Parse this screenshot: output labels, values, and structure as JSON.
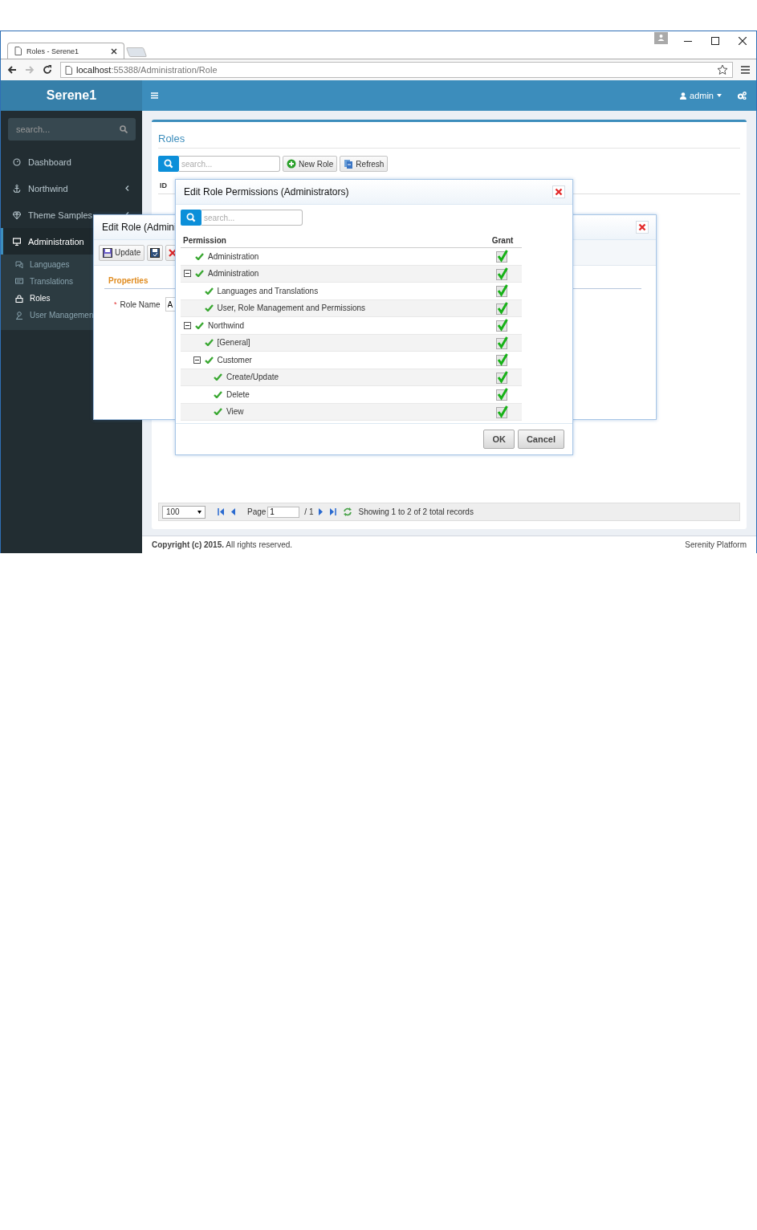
{
  "browser": {
    "tab_title": "Roles - Serene1",
    "url_host": "localhost",
    "url_path": ":55388/Administration/Role"
  },
  "header": {
    "logo": "Serene1",
    "user": "admin"
  },
  "sidebar": {
    "search_placeholder": "search...",
    "items": [
      {
        "label": "Dashboard",
        "selected": false
      },
      {
        "label": "Northwind",
        "selected": false,
        "expanded": false
      },
      {
        "label": "Theme Samples",
        "selected": false,
        "expanded": false
      },
      {
        "label": "Administration",
        "selected": true,
        "expanded": true,
        "children": [
          {
            "label": "Languages",
            "selected": false
          },
          {
            "label": "Translations",
            "selected": false
          },
          {
            "label": "Roles",
            "selected": true
          },
          {
            "label": "User Managemen",
            "selected": false
          }
        ]
      }
    ]
  },
  "page": {
    "title": "Roles",
    "search_placeholder": "search...",
    "buttons": [
      "New Role",
      "Refresh"
    ],
    "columns": [
      "ID"
    ],
    "pager": {
      "page_size": "100",
      "page_label": "Page",
      "page": "1",
      "page_total": "/ 1",
      "status": "Showing 1 to 2 of 2 total records"
    }
  },
  "footer": {
    "copyright": "**Copyright (c) 2015.** All rights reserved.",
    "platform": "Serenity Platform"
  },
  "edit_role_dialog": {
    "title": "Edit Role (Admini",
    "buttons": [
      "Update"
    ],
    "tab": "Properties",
    "field": {
      "required_mark": "*",
      "label": "Role Name",
      "value": "A"
    }
  },
  "permissions_dialog": {
    "title": "Edit Role Permissions (Administrators)",
    "search_placeholder": "search...",
    "columns": [
      "Permission",
      "Grant"
    ],
    "tree": [
      {
        "label": "Administration",
        "checked": true
      },
      {
        "label": "Administration",
        "checked": true,
        "expanded": true,
        "children": [
          {
            "label": "Languages and Translations",
            "checked": true
          },
          {
            "label": "User, Role Management and Permissions",
            "checked": true
          }
        ]
      },
      {
        "label": "Northwind",
        "checked": true,
        "expanded": true,
        "children": [
          {
            "label": "[General]",
            "checked": true
          },
          {
            "label": "Customer",
            "checked": true,
            "expanded": true,
            "children": [
              {
                "label": "Create/Update",
                "checked": true
              },
              {
                "label": "Delete",
                "checked": true
              },
              {
                "label": "View",
                "checked": true
              }
            ]
          }
        ]
      }
    ],
    "buttons": [
      "OK",
      "Cancel"
    ]
  }
}
